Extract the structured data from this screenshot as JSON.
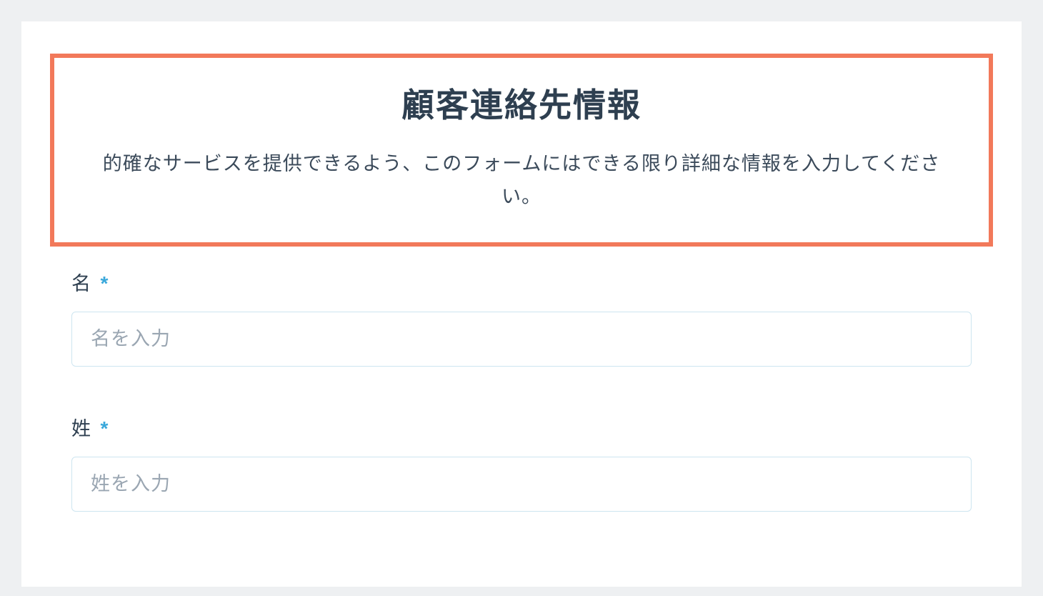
{
  "header": {
    "title": "顧客連絡先情報",
    "description": "的確なサービスを提供できるよう、このフォームにはできる限り詳細な情報を入力してください。"
  },
  "fields": {
    "first_name": {
      "label": "名",
      "required_mark": "*",
      "placeholder": "名を入力"
    },
    "last_name": {
      "label": "姓",
      "required_mark": "*",
      "placeholder": "姓を入力"
    }
  }
}
